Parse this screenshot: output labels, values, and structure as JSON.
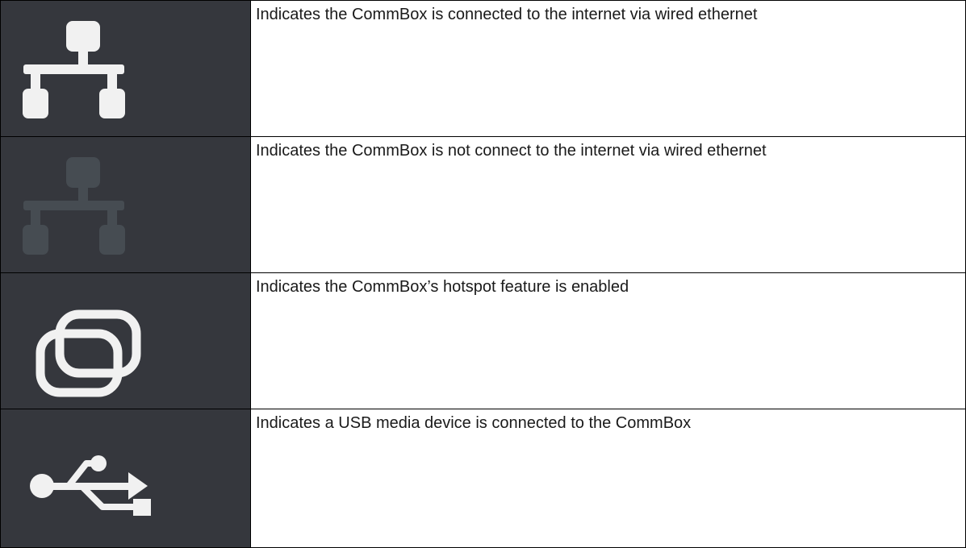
{
  "colors": {
    "icon_background": "#35373d",
    "icon_active": "#f1f1f1",
    "icon_inactive": "#464c52",
    "text": "#1a1a1a",
    "border": "#000000"
  },
  "rows": [
    {
      "icon": "ethernet-connected-icon",
      "description": "Indicates the CommBox is connected to the internet via wired ethernet"
    },
    {
      "icon": "ethernet-disconnected-icon",
      "description": "Indicates the CommBox is not connect to the internet via wired ethernet"
    },
    {
      "icon": "hotspot-icon",
      "description": "Indicates the CommBox’s hotspot feature is enabled"
    },
    {
      "icon": "usb-icon",
      "description": "Indicates a USB media device is connected to the CommBox"
    }
  ]
}
